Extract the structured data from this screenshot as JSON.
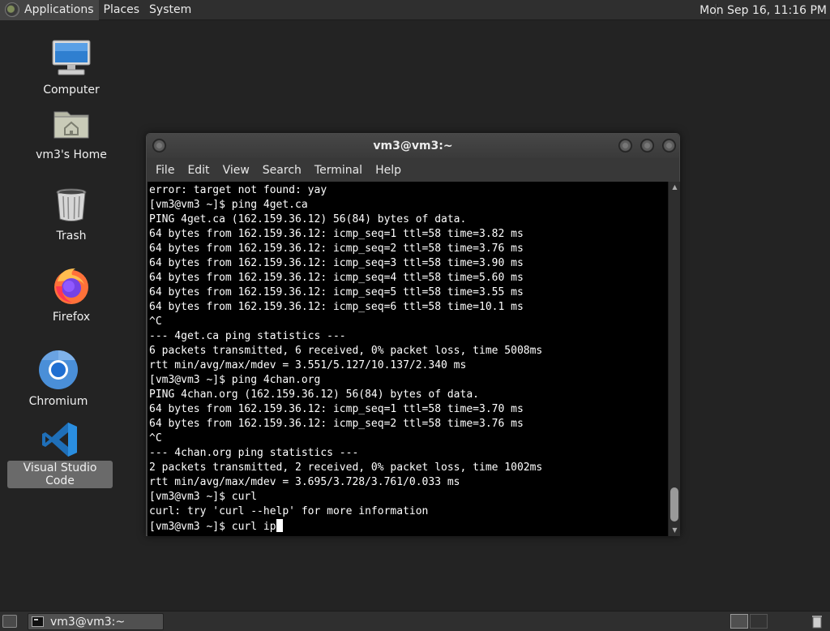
{
  "top_panel": {
    "applications": "Applications",
    "places": "Places",
    "system": "System",
    "clock": "Mon Sep 16, 11:16 PM"
  },
  "desktop": {
    "icons": [
      {
        "label": "Computer",
        "icon": "computer-icon"
      },
      {
        "label": "vm3's Home",
        "icon": "home-folder-icon"
      },
      {
        "label": "Trash",
        "icon": "trash-icon"
      },
      {
        "label": "Firefox",
        "icon": "firefox-icon"
      },
      {
        "label": "Chromium",
        "icon": "chromium-icon"
      },
      {
        "label": "Visual Studio Code",
        "icon": "vscode-icon",
        "selected": true
      }
    ]
  },
  "terminal": {
    "title": "vm3@vm3:~",
    "menu": [
      "File",
      "Edit",
      "View",
      "Search",
      "Terminal",
      "Help"
    ],
    "lines": [
      "error: target not found: yay",
      "[vm3@vm3 ~]$ ping 4get.ca",
      "PING 4get.ca (162.159.36.12) 56(84) bytes of data.",
      "64 bytes from 162.159.36.12: icmp_seq=1 ttl=58 time=3.82 ms",
      "64 bytes from 162.159.36.12: icmp_seq=2 ttl=58 time=3.76 ms",
      "64 bytes from 162.159.36.12: icmp_seq=3 ttl=58 time=3.90 ms",
      "64 bytes from 162.159.36.12: icmp_seq=4 ttl=58 time=5.60 ms",
      "64 bytes from 162.159.36.12: icmp_seq=5 ttl=58 time=3.55 ms",
      "64 bytes from 162.159.36.12: icmp_seq=6 ttl=58 time=10.1 ms",
      "^C",
      "--- 4get.ca ping statistics ---",
      "6 packets transmitted, 6 received, 0% packet loss, time 5008ms",
      "rtt min/avg/max/mdev = 3.551/5.127/10.137/2.340 ms",
      "[vm3@vm3 ~]$ ping 4chan.org",
      "PING 4chan.org (162.159.36.12) 56(84) bytes of data.",
      "64 bytes from 162.159.36.12: icmp_seq=1 ttl=58 time=3.70 ms",
      "64 bytes from 162.159.36.12: icmp_seq=2 ttl=58 time=3.76 ms",
      "^C",
      "--- 4chan.org ping statistics ---",
      "2 packets transmitted, 2 received, 0% packet loss, time 1002ms",
      "rtt min/avg/max/mdev = 3.695/3.728/3.761/0.033 ms",
      "[vm3@vm3 ~]$ curl",
      "curl: try 'curl --help' for more information"
    ],
    "prompt_line": "[vm3@vm3 ~]$ curl ip"
  },
  "bottom_panel": {
    "taskbar_item": "vm3@vm3:~"
  }
}
